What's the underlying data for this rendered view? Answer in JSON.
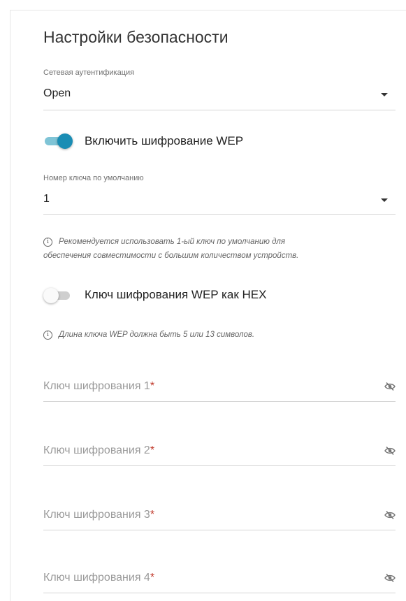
{
  "section": {
    "title": "Настройки безопасности"
  },
  "auth": {
    "label": "Сетевая аутентификация",
    "value": "Open"
  },
  "wep_toggle": {
    "label": "Включить шифрование WEP",
    "on": true
  },
  "default_key": {
    "label": "Номер ключа по умолчанию",
    "value": "1"
  },
  "hint_default_key": {
    "line1": "Рекомендуется использовать 1-ый ключ по умолчанию для",
    "line2": "обеспечения совместимости с большим количеством устройств."
  },
  "hex_toggle": {
    "label": "Ключ шифрования WEP как HEX",
    "on": false
  },
  "hint_length": {
    "text": "Длина ключа WEP должна быть 5 или 13 символов."
  },
  "keys": [
    {
      "placeholder": "Ключ шифрования 1",
      "required_mark": "*"
    },
    {
      "placeholder": "Ключ шифрования 2",
      "required_mark": "*"
    },
    {
      "placeholder": "Ключ шифрования 3",
      "required_mark": "*"
    },
    {
      "placeholder": "Ключ шифрования 4",
      "required_mark": "*"
    }
  ],
  "icons": {
    "info": "info-icon",
    "eye": "eye-off-icon",
    "caret": "chevron-down-icon"
  },
  "colors": {
    "accent": "#1a8db4",
    "required": "#c0392b"
  }
}
